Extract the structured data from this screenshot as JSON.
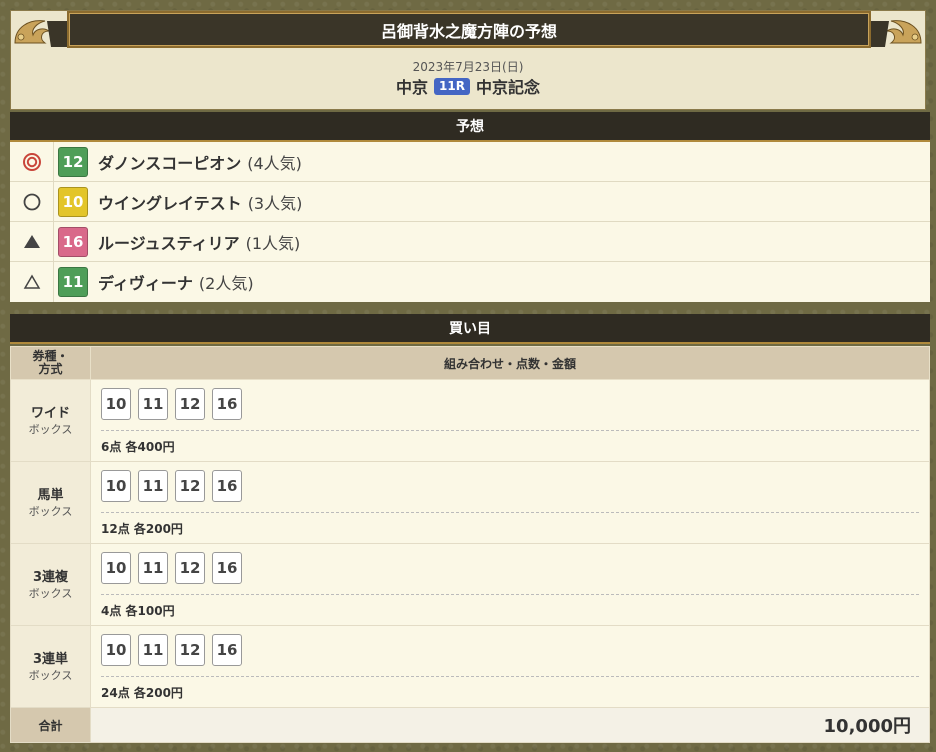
{
  "header": {
    "title": "呂御背水之魔方陣の予想",
    "date": "2023年7月23日(日)",
    "venue": "中京",
    "race_no": "11R",
    "race_name": "中京記念"
  },
  "prediction": {
    "heading": "予想",
    "rows": [
      {
        "mark": "double-circle",
        "number": "12",
        "color": "#4f9e58",
        "name": "ダノンスコーピオン",
        "popularity": "(4人気)"
      },
      {
        "mark": "circle",
        "number": "10",
        "color": "#e3c52a",
        "name": "ウイングレイテスト",
        "popularity": "(3人気)"
      },
      {
        "mark": "filled-triangle",
        "number": "16",
        "color": "#d9698a",
        "name": "ルージュスティリア",
        "popularity": "(1人気)"
      },
      {
        "mark": "triangle",
        "number": "11",
        "color": "#4f9e58",
        "name": "ディヴィーナ",
        "popularity": "(2人気)"
      }
    ]
  },
  "bets": {
    "heading": "買い目",
    "col_type": "券種・方式",
    "col_combo": "組み合わせ・点数・金額",
    "rows": [
      {
        "type": "ワイド",
        "method": "ボックス",
        "numbers": [
          "10",
          "11",
          "12",
          "16"
        ],
        "summary": "6点 各400円"
      },
      {
        "type": "馬単",
        "method": "ボックス",
        "numbers": [
          "10",
          "11",
          "12",
          "16"
        ],
        "summary": "12点 各200円"
      },
      {
        "type": "3連複",
        "method": "ボックス",
        "numbers": [
          "10",
          "11",
          "12",
          "16"
        ],
        "summary": "4点 各100円"
      },
      {
        "type": "3連単",
        "method": "ボックス",
        "numbers": [
          "10",
          "11",
          "12",
          "16"
        ],
        "summary": "24点 各200円"
      }
    ],
    "total_label": "合計",
    "total_value": "10,000円"
  }
}
